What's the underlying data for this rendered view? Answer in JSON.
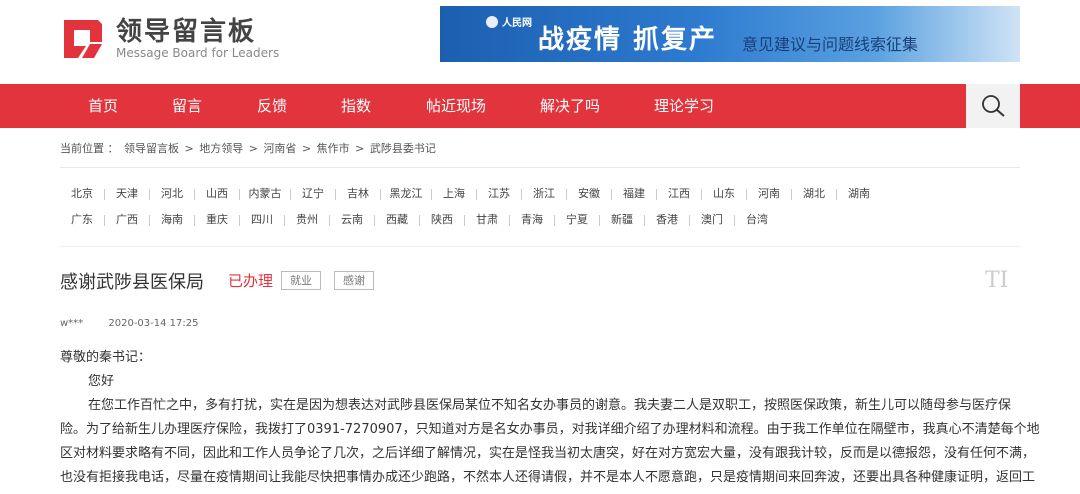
{
  "logo": {
    "title": "领导留言板",
    "subtitle": "Message Board for Leaders"
  },
  "banner": {
    "site": "人民网",
    "bold": "战疫情 抓复产",
    "rest": "意见建议与问题线索征集"
  },
  "nav": [
    "首页",
    "留言",
    "反馈",
    "指数",
    "帖近现场",
    "解决了吗",
    "理论学习"
  ],
  "breadcrumb": [
    "当前位置 ：",
    "领导留言板",
    ">",
    "地方领导",
    ">",
    "河南省",
    ">",
    "焦作市",
    ">",
    "武陟县委书记"
  ],
  "provinces_row1": [
    "北京",
    "天津",
    "河北",
    "山西",
    "内蒙古",
    "辽宁",
    "吉林",
    "黑龙江",
    "上海",
    "江苏",
    "浙江",
    "安徽",
    "福建",
    "江西",
    "山东",
    "河南",
    "湖北",
    "湖南"
  ],
  "provinces_row2": [
    "广东",
    "广西",
    "海南",
    "重庆",
    "四川",
    "贵州",
    "云南",
    "西藏",
    "陕西",
    "甘肃",
    "青海",
    "宁夏",
    "新疆",
    "香港",
    "澳门",
    "台湾"
  ],
  "message": {
    "title": "感谢武陟县医保局",
    "status": "已办理",
    "tags": [
      "就业",
      "感谢"
    ],
    "font_toggle": "TI",
    "author": "w***",
    "date": "2020-03-14 17:25",
    "lines": [
      "尊敬的秦书记：",
      "您好",
      "在您工作百忙之中，多有打扰，实在是因为想表达对武陟县医保局某位不知名女办事员的谢意。我夫妻二人是双职工，按照医保政策，新生儿可以随母参与医疗保",
      "险。为了给新生儿办理医疗保险，我拨打了0391-7270907，只知道对方是名女办事员，对我详细介绍了办理材料和流程。由于我工作单位在隔壁市，我真心不清楚每个地",
      "区对材料要求略有不同，因此和工作人员争论了几次，之后详细了解情况，实在是怪我当初太唐突，好在对方宽宏大量，没有跟我计较，反而是以德报怨，没有任何不满，",
      "也没有拒接我电话，尽量在疫情期间让我能尽快把事情办成还少跑路，不然本人还得请假，并不是本人不愿意跑，只是疫情期间来回奔波，还要出具各种健康证明，返回工"
    ]
  }
}
